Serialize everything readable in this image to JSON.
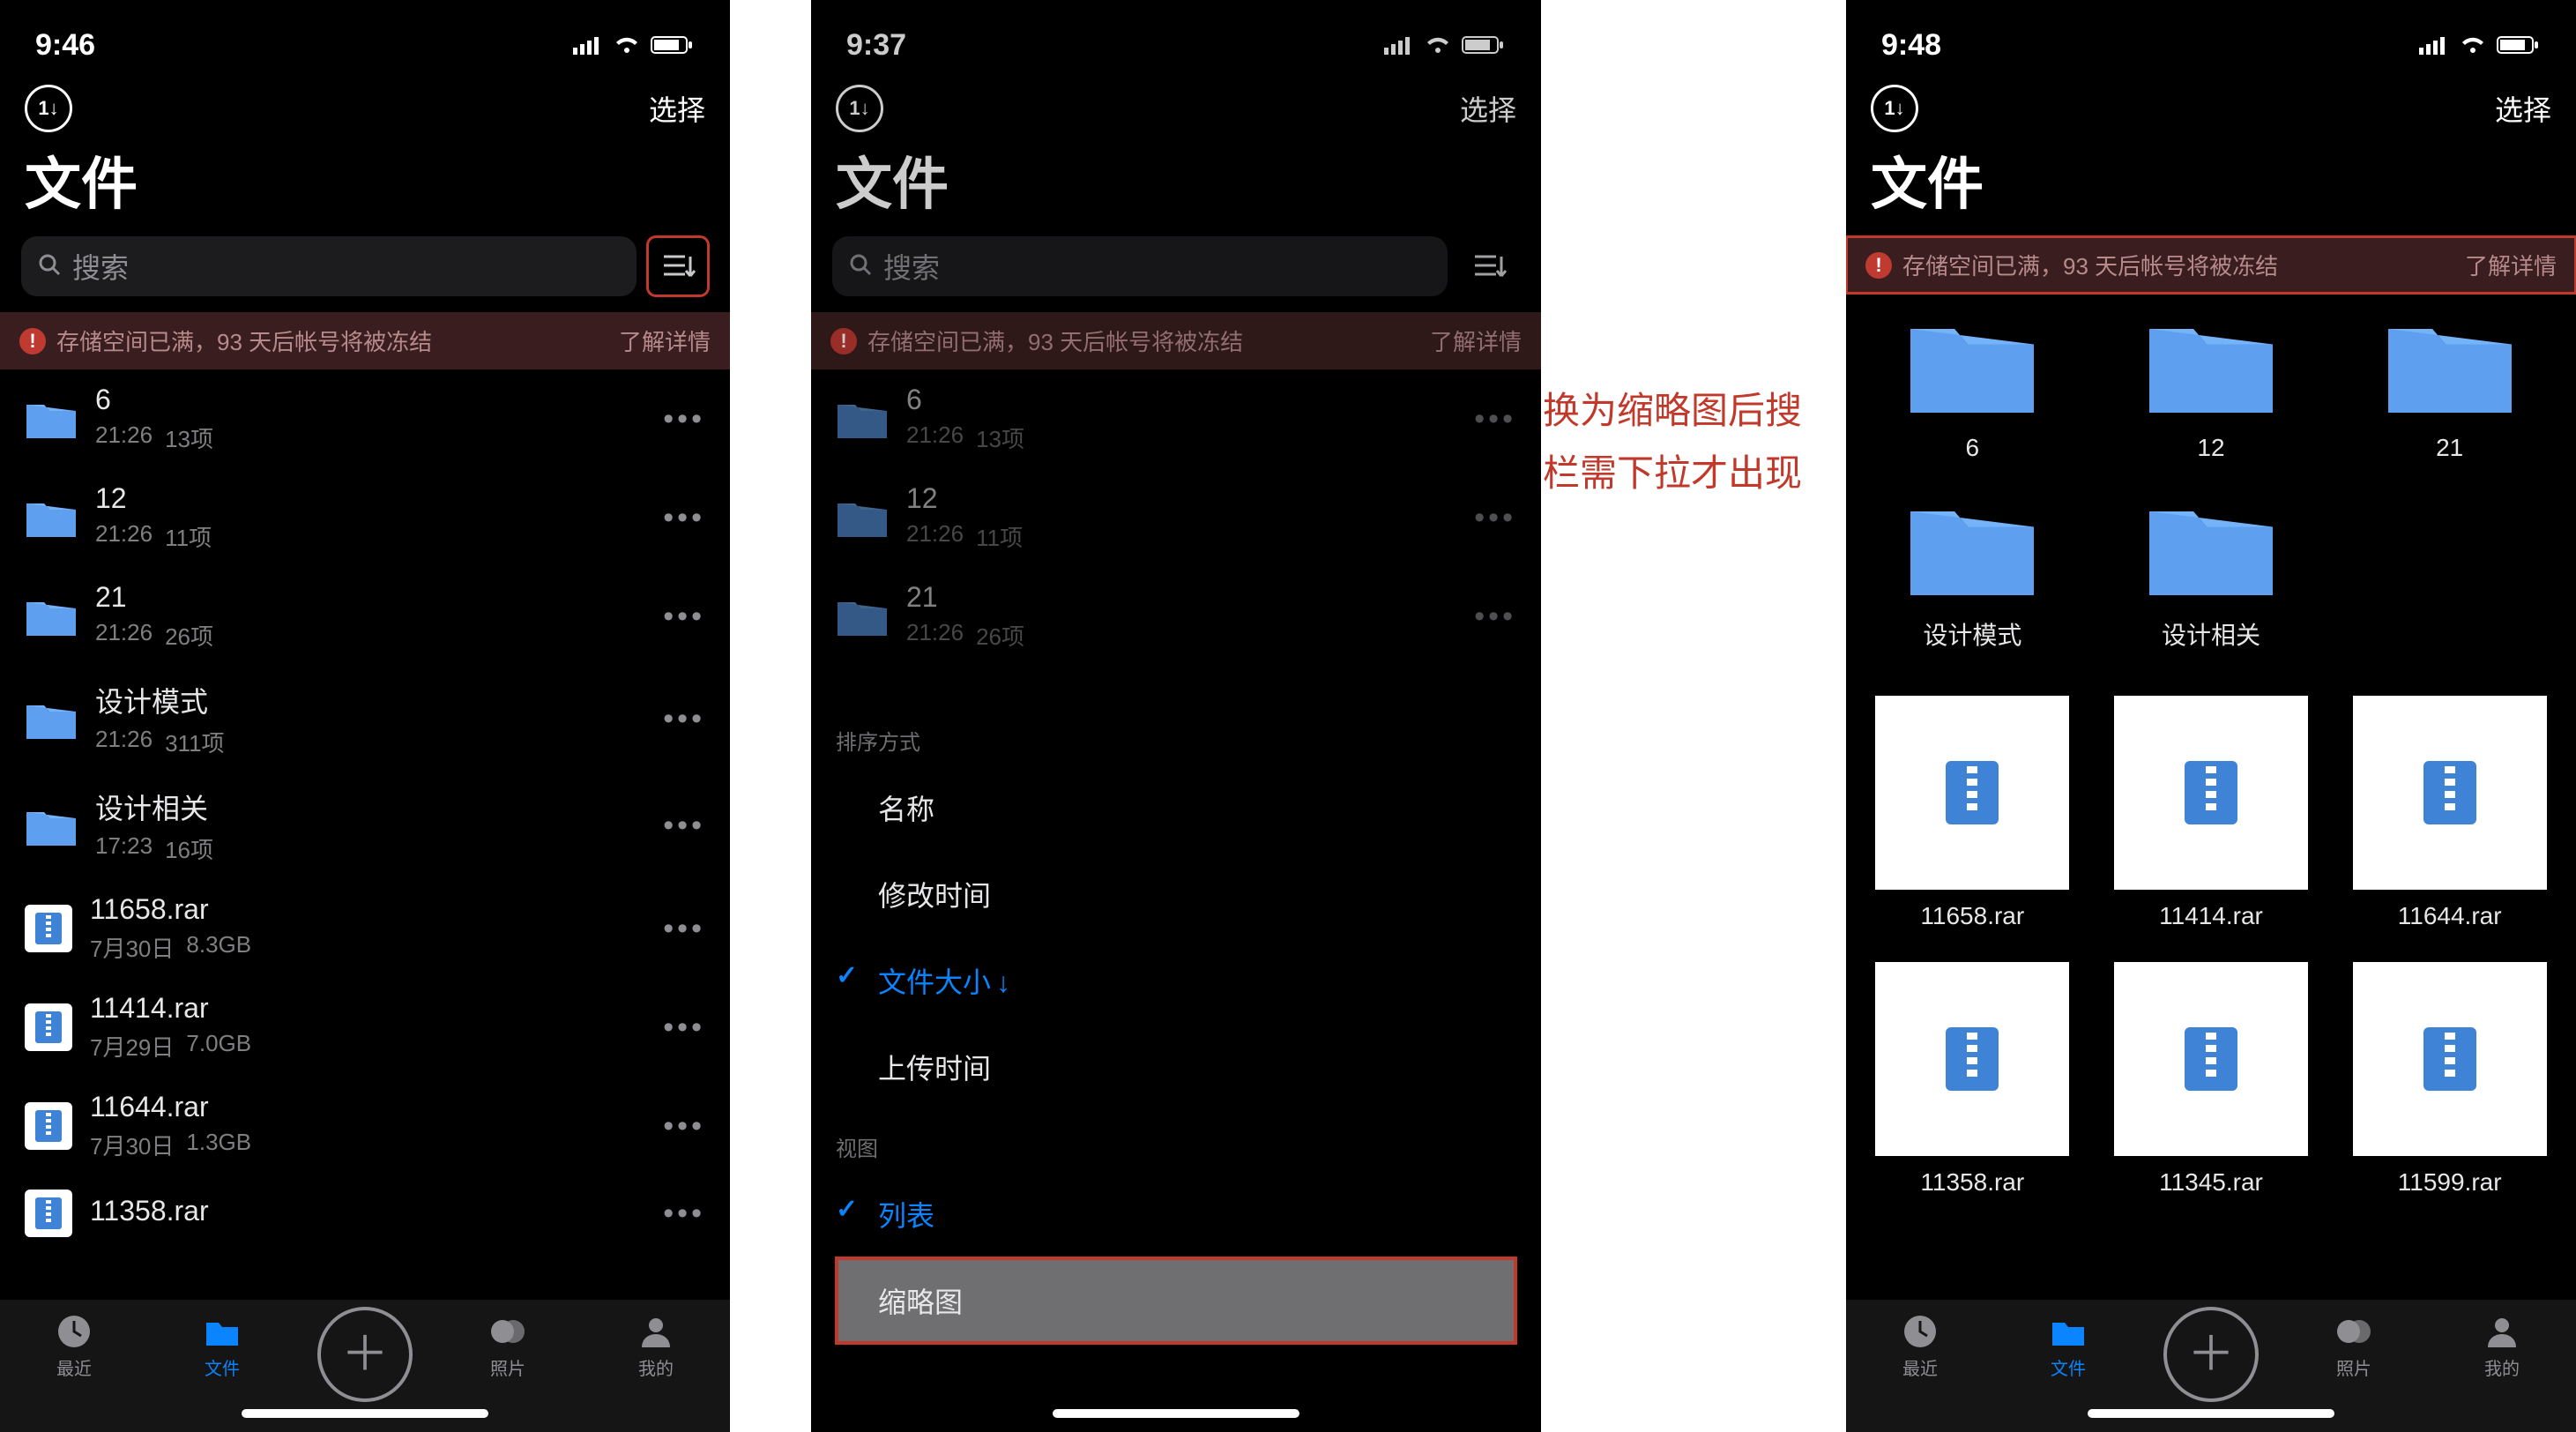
{
  "note": "切换为缩略图后搜索栏需下拉才出现",
  "screens": [
    {
      "time": "9:46",
      "select_label": "选择",
      "title": "文件",
      "search_placeholder": "搜索",
      "sort_toggle_highlight": true,
      "banner": {
        "text": "存储空间已满，93 天后帐号将被冻结",
        "link": "了解详情",
        "highlight": false
      },
      "list": [
        {
          "type": "folder",
          "name": "6",
          "sub1": "21:26",
          "sub2": "13项"
        },
        {
          "type": "folder",
          "name": "12",
          "sub1": "21:26",
          "sub2": "11项"
        },
        {
          "type": "folder",
          "name": "21",
          "sub1": "21:26",
          "sub2": "26项"
        },
        {
          "type": "folder",
          "name": "设计模式",
          "sub1": "21:26",
          "sub2": "311项"
        },
        {
          "type": "folder",
          "name": "设计相关",
          "sub1": "17:23",
          "sub2": "16项"
        },
        {
          "type": "rar",
          "name": "11658.rar",
          "sub1": "7月30日",
          "sub2": "8.3GB"
        },
        {
          "type": "rar",
          "name": "11414.rar",
          "sub1": "7月29日",
          "sub2": "7.0GB"
        },
        {
          "type": "rar",
          "name": "11644.rar",
          "sub1": "7月30日",
          "sub2": "1.3GB"
        },
        {
          "type": "rar",
          "name": "11358.rar",
          "sub1": "",
          "sub2": ""
        }
      ],
      "tabbar": {
        "recent": "最近",
        "files": "文件",
        "photos": "照片",
        "mine": "我的"
      }
    },
    {
      "time": "9:37",
      "select_label": "选择",
      "title": "文件",
      "search_placeholder": "搜索",
      "sort_toggle_highlight": false,
      "banner": {
        "text": "存储空间已满，93 天后帐号将被冻结",
        "link": "了解详情",
        "highlight": false
      },
      "list": [
        {
          "type": "folder",
          "name": "6",
          "sub1": "21:26",
          "sub2": "13项"
        },
        {
          "type": "folder",
          "name": "12",
          "sub1": "21:26",
          "sub2": "11项"
        },
        {
          "type": "folder",
          "name": "21",
          "sub1": "21:26",
          "sub2": "26项"
        }
      ],
      "menu": {
        "sort_label": "排序方式",
        "sort_options": [
          {
            "label": "名称",
            "selected": false,
            "arrow": ""
          },
          {
            "label": "修改时间",
            "selected": false,
            "arrow": ""
          },
          {
            "label": "文件大小",
            "selected": true,
            "arrow": "↓"
          },
          {
            "label": "上传时间",
            "selected": false,
            "arrow": ""
          }
        ],
        "view_label": "视图",
        "view_options": [
          {
            "label": "列表",
            "selected": true,
            "highlight": false
          },
          {
            "label": "缩略图",
            "selected": false,
            "highlight": true
          }
        ]
      }
    },
    {
      "time": "9:48",
      "select_label": "选择",
      "title": "文件",
      "banner": {
        "text": "存储空间已满，93 天后帐号将被冻结",
        "link": "了解详情",
        "highlight": true
      },
      "grid": {
        "folders": [
          {
            "name": "6"
          },
          {
            "name": "12"
          },
          {
            "name": "21"
          },
          {
            "name": "设计模式"
          },
          {
            "name": "设计相关"
          }
        ],
        "files": [
          {
            "name": "11658.rar"
          },
          {
            "name": "11414.rar"
          },
          {
            "name": "11644.rar"
          },
          {
            "name": "11358.rar"
          },
          {
            "name": "11345.rar"
          },
          {
            "name": "11599.rar"
          }
        ]
      },
      "tabbar": {
        "recent": "最近",
        "files": "文件",
        "photos": "照片",
        "mine": "我的"
      }
    }
  ]
}
